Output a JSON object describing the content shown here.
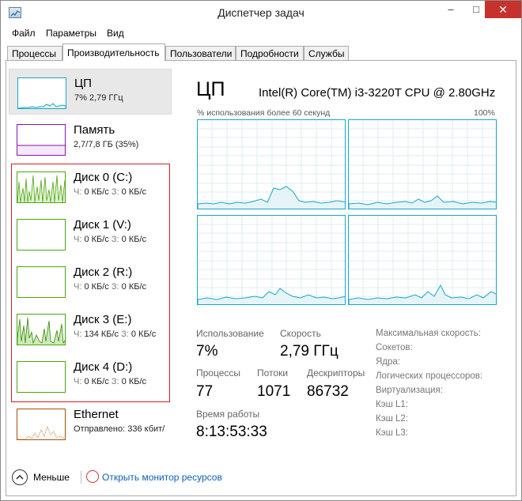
{
  "window": {
    "title": "Диспетчер задач",
    "minimize": "–",
    "maximize": "□",
    "close": "✕"
  },
  "menu": [
    "Файл",
    "Параметры",
    "Вид"
  ],
  "tabs": [
    {
      "label": "Процессы",
      "active": false
    },
    {
      "label": "Производительность",
      "active": true
    },
    {
      "label": "Пользователи",
      "active": false
    },
    {
      "label": "Подробности",
      "active": false
    },
    {
      "label": "Службы",
      "active": false
    }
  ],
  "sidebar": [
    {
      "name": "ЦП",
      "sub": "7% 2,79 ГГц",
      "color": "#17a8c8",
      "selected": true
    },
    {
      "name": "Память",
      "sub": "2,7/7,8 ГБ (35%)",
      "color": "#8b12ae",
      "selected": false
    },
    {
      "name": "Диск 0 (C:)",
      "read_label": "Ч:",
      "read": "0 КБ/с",
      "write_label": "З:",
      "write": "0 КБ/с",
      "color": "#4ca60c",
      "selected": false
    },
    {
      "name": "Диск 1 (V:)",
      "read_label": "Ч:",
      "read": "0 КБ/с",
      "write_label": "З:",
      "write": "0 КБ/с",
      "color": "#4ca60c",
      "selected": false
    },
    {
      "name": "Диск 2 (R:)",
      "read_label": "Ч:",
      "read": "0 КБ/с",
      "write_label": "З:",
      "write": "0 КБ/с",
      "color": "#4ca60c",
      "selected": false
    },
    {
      "name": "Диск 3 (E:)",
      "read_label": "Ч:",
      "read": "134 КБ/с",
      "write_label": "З:",
      "write": "0 КБ/с",
      "color": "#4ca60c",
      "selected": false
    },
    {
      "name": "Диск 4 (D:)",
      "read_label": "Ч:",
      "read": "0 КБ/с",
      "write_label": "З:",
      "write": "0 КБ/с",
      "color": "#4ca60c",
      "selected": false
    },
    {
      "name": "Ethernet",
      "sub_label": "Отправлено:",
      "sub_value": "336 кбит/",
      "color": "#a74f01",
      "selected": false
    }
  ],
  "main": {
    "title": "ЦП",
    "model": "Intel(R) Core(TM) i3-3220T CPU @ 2.80GHz",
    "usage_label": "% использования более 60 секунд",
    "max_label": "100%"
  },
  "stats": {
    "usage_label": "Использование",
    "usage_value": "7%",
    "speed_label": "Скорость",
    "speed_value": "2,79 ГГц",
    "processes_label": "Процессы",
    "processes_value": "77",
    "threads_label": "Потоки",
    "threads_value": "1071",
    "handles_label": "Дескрипторы",
    "handles_value": "86732",
    "uptime_label": "Время работы",
    "uptime_value": "8:13:53:33"
  },
  "right_labels": [
    "Максимальная скорость:",
    "Сокетов:",
    "Ядра:",
    "Логических процессоров:",
    "Виртуализация:",
    "Кэш L1:",
    "Кэш L2:",
    "Кэш L3:"
  ],
  "footer": {
    "less_label": "Меньше",
    "monitor_label": "Открыть монитор ресурсов"
  },
  "colors": {
    "cpu": "#17a8c8",
    "memory": "#8b12ae",
    "disk": "#4ca60c",
    "ethernet": "#a74f01",
    "highlight": "#d11f26"
  }
}
